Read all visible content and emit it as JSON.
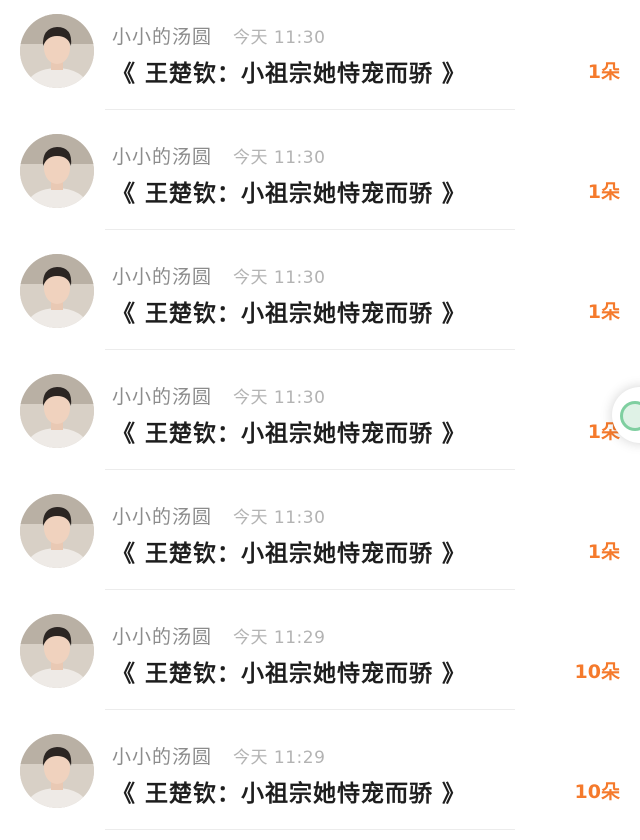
{
  "messages": [
    {
      "username": "小小的汤圆",
      "time": "今天 11:30",
      "text": "《 王楚钦：小祖宗她恃宠而骄 》",
      "gift": "1朵"
    },
    {
      "username": "小小的汤圆",
      "time": "今天 11:30",
      "text": "《 王楚钦：小祖宗她恃宠而骄 》",
      "gift": "1朵"
    },
    {
      "username": "小小的汤圆",
      "time": "今天 11:30",
      "text": "《 王楚钦：小祖宗她恃宠而骄 》",
      "gift": "1朵"
    },
    {
      "username": "小小的汤圆",
      "time": "今天 11:30",
      "text": "《 王楚钦：小祖宗她恃宠而骄 》",
      "gift": "1朵"
    },
    {
      "username": "小小的汤圆",
      "time": "今天 11:30",
      "text": "《 王楚钦：小祖宗她恃宠而骄 》",
      "gift": "1朵"
    },
    {
      "username": "小小的汤圆",
      "time": "今天 11:29",
      "text": "《 王楚钦：小祖宗她恃宠而骄 》",
      "gift": "10朵"
    },
    {
      "username": "小小的汤圆",
      "time": "今天 11:29",
      "text": "《 王楚钦：小祖宗她恃宠而骄 》",
      "gift": "10朵"
    }
  ],
  "colors": {
    "username": "#8c8c8c",
    "time": "#b3b3b3",
    "message": "#1e1e1e",
    "gift": "#f57a2c"
  }
}
